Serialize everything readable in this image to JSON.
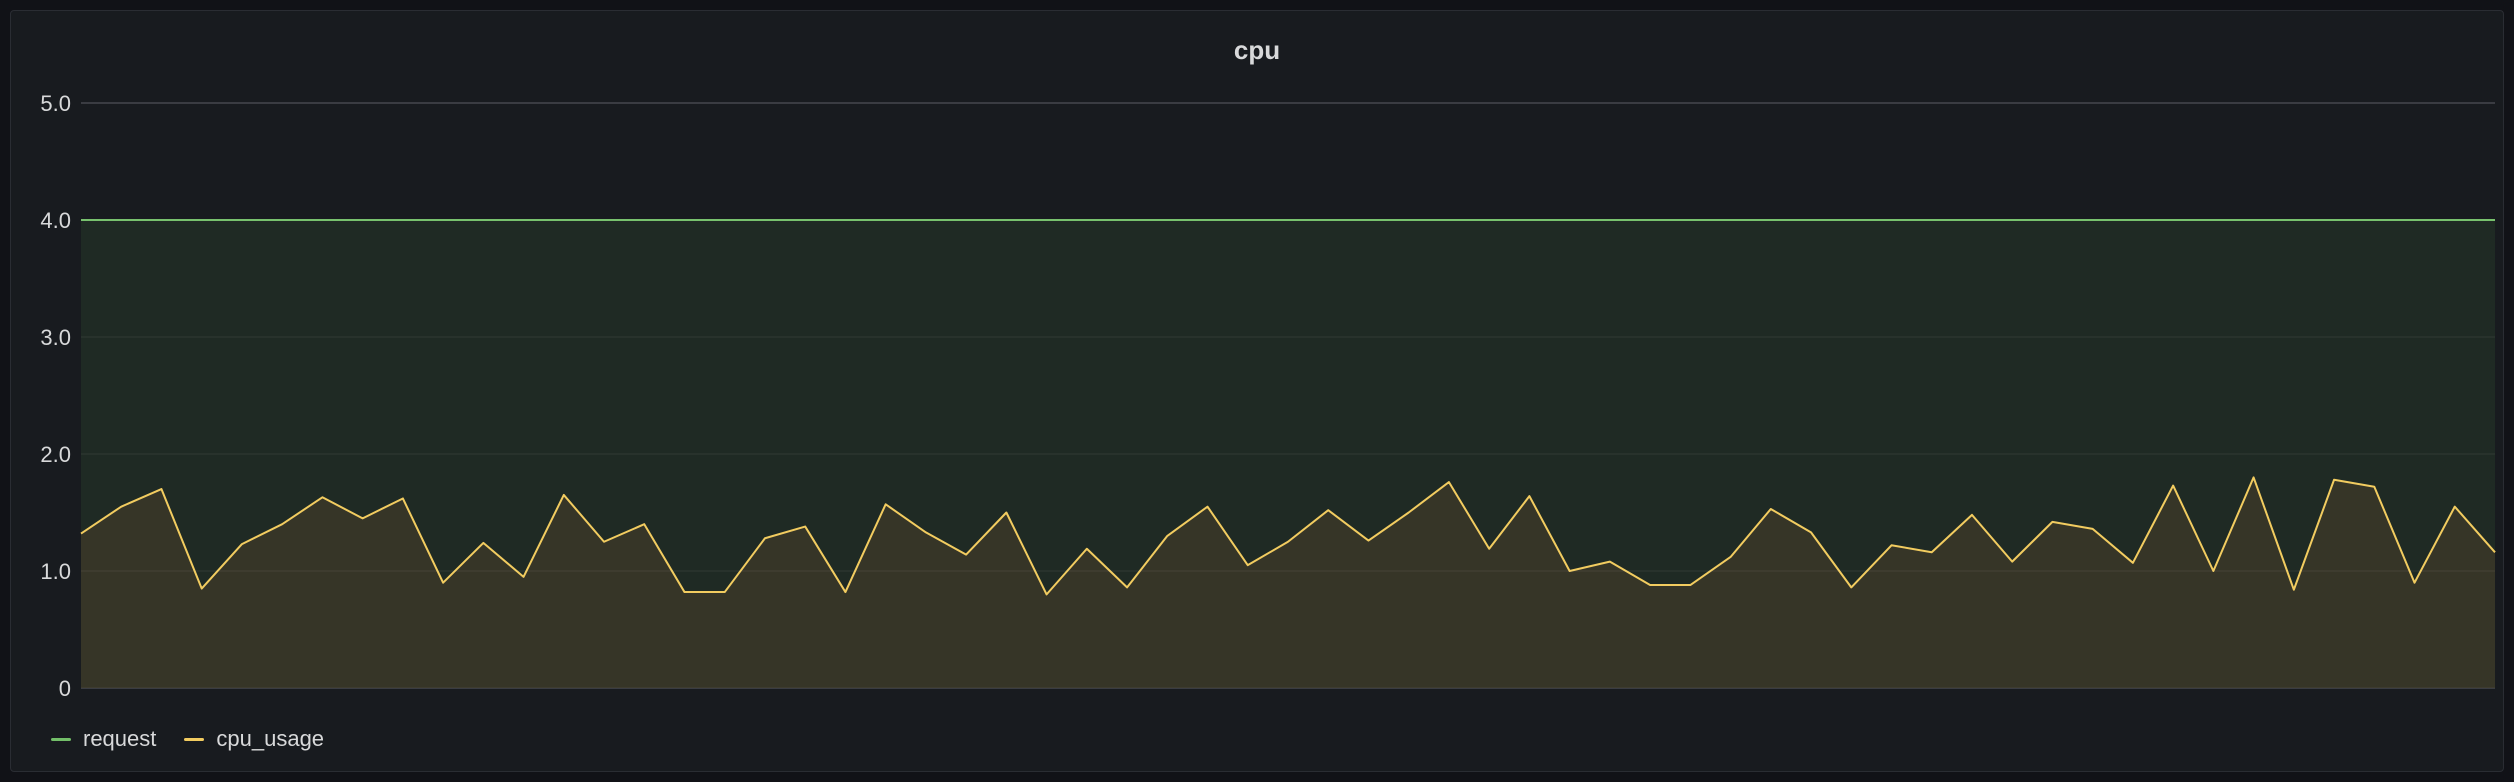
{
  "panel": {
    "title": "cpu"
  },
  "colors": {
    "background": "#111217",
    "panel": "#181b1f",
    "grid": "#3b3e45",
    "text": "#d8d9da",
    "request": "#73bf69",
    "request_fill": "#1f2a24",
    "cpu_usage": "#f2cc60",
    "cpu_usage_fill": "#363527"
  },
  "chart_data": {
    "type": "area",
    "title": "cpu",
    "xlabel": "",
    "ylabel": "",
    "ylim": [
      0,
      5
    ],
    "yticks": [
      {
        "value": 0,
        "label": "0"
      },
      {
        "value": 1,
        "label": "1.0"
      },
      {
        "value": 2,
        "label": "2.0"
      },
      {
        "value": 3,
        "label": "3.0"
      },
      {
        "value": 4,
        "label": "4.0"
      },
      {
        "value": 5,
        "label": "5.0"
      }
    ],
    "grid": true,
    "legend_position": "bottom-left",
    "series": [
      {
        "name": "request",
        "color": "#73bf69",
        "values": [
          4,
          4,
          4,
          4,
          4,
          4,
          4,
          4,
          4,
          4,
          4,
          4,
          4,
          4,
          4,
          4,
          4,
          4,
          4,
          4,
          4,
          4,
          4,
          4,
          4,
          4,
          4,
          4,
          4,
          4,
          4,
          4,
          4,
          4,
          4,
          4,
          4,
          4,
          4,
          4,
          4,
          4,
          4,
          4,
          4,
          4,
          4,
          4,
          4,
          4,
          4,
          4,
          4,
          4,
          4,
          4,
          4,
          4,
          4,
          4,
          4
        ]
      },
      {
        "name": "cpu_usage",
        "color": "#f2cc60",
        "values": [
          1.32,
          1.55,
          1.7,
          0.85,
          1.23,
          1.4,
          1.63,
          1.45,
          1.62,
          0.9,
          1.24,
          0.95,
          1.65,
          1.25,
          1.4,
          0.82,
          0.82,
          1.28,
          1.38,
          0.82,
          1.57,
          1.33,
          1.14,
          1.5,
          0.8,
          1.19,
          0.86,
          1.3,
          1.55,
          1.05,
          1.25,
          1.52,
          1.26,
          1.5,
          1.76,
          1.19,
          1.64,
          1.0,
          1.08,
          0.88,
          0.88,
          1.12,
          1.53,
          1.33,
          0.86,
          1.22,
          1.16,
          1.48,
          1.08,
          1.42,
          1.36,
          1.07,
          1.73,
          1.0,
          1.8,
          0.84,
          1.78,
          1.72,
          0.9,
          1.55,
          1.16
        ]
      }
    ]
  },
  "legend": {
    "items": [
      {
        "label": "request",
        "color": "#73bf69"
      },
      {
        "label": "cpu_usage",
        "color": "#f2cc60"
      }
    ]
  }
}
